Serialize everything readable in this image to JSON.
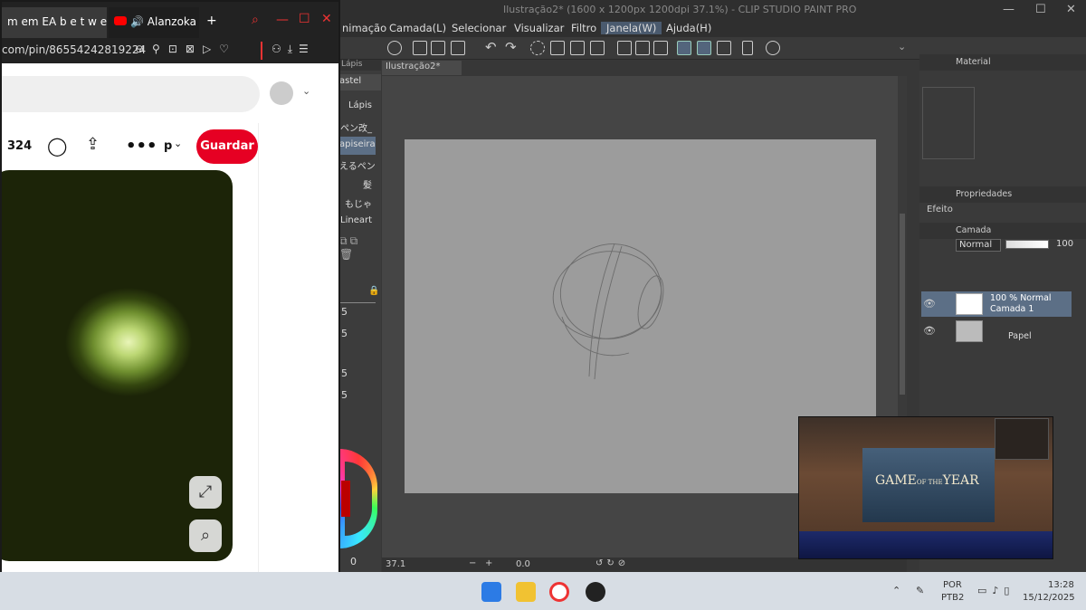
{
  "csp": {
    "title": "Ilustração2* (1600 x 1200px 1200dpi 37.1%) - CLIP STUDIO PAINT PRO",
    "menu": [
      "nimação",
      "Camada(L)",
      "Selecionar",
      "Visualizar",
      "Filtro",
      "Janela(W)",
      "Ajuda(H)"
    ],
    "canvas_tab": "Ilustração2*",
    "subtool_group_tab": "Lápis",
    "subtool_header": "astel",
    "subtools": [
      "Lápis",
      "ペン改_",
      "apiseira",
      "えるペン",
      "髪",
      "もじゃ",
      "Lineart"
    ],
    "size_values": [
      "5",
      "5",
      "5",
      "5"
    ],
    "zoom_readout": "37.1",
    "rotation_readout": "0.0",
    "color_wheel_value": "0",
    "panels": {
      "material": "Material",
      "properties": "Propriedades",
      "effect": "Efeito",
      "layer": "Camada",
      "blend_mode": "Normal",
      "opacity": "100"
    },
    "layers": [
      {
        "info": "100 % Normal",
        "name": "Camada 1"
      },
      {
        "info": "",
        "name": "Papel"
      }
    ]
  },
  "browser": {
    "tab1": "m em EA b e t w e",
    "tab2": "Alanzoka",
    "address": "com/pin/86554242819224",
    "pin_count": "324",
    "profile_initial": "p",
    "save_button": "Guardar"
  },
  "webcam": {
    "overlay_text_a": "GAME",
    "overlay_text_b": "OF THE",
    "overlay_text_c": "YEAR"
  },
  "taskbar": {
    "lang": "POR",
    "layout": "PTB2",
    "time": "13:28",
    "date": "15/12/2025"
  },
  "colors": {
    "accent_red": "#e60023",
    "csp_highlight": "#5c6f86"
  }
}
